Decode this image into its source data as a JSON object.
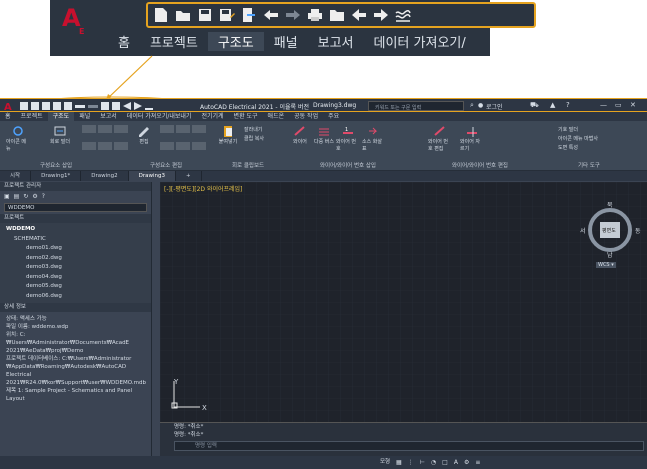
{
  "zoom": {
    "logo_letter": "A",
    "logo_sub": "E",
    "toolbar_icons": [
      "new-icon",
      "open-icon",
      "save-icon",
      "save-as-icon",
      "publish-icon",
      "undo-icon",
      "redo-icon",
      "print-icon",
      "folder-icon",
      "back-icon",
      "forward-icon",
      "workspace-icon"
    ],
    "tabs": [
      "홈",
      "프로젝트",
      "구조도",
      "패널",
      "보고서",
      "데이터 가져오기/"
    ]
  },
  "title": {
    "app": "AutoCAD Electrical 2021 - 이율록 버전",
    "file": "Drawing3.dwg",
    "search_placeholder": "키워드 또는 구문 입력",
    "login": "로그인"
  },
  "ribbon_tabs": [
    "홈",
    "프로젝트",
    "구조도",
    "패널",
    "보고서",
    "데이터 가져오기/내보내기",
    "전기기계",
    "변환 도구",
    "애드온",
    "공동 작업",
    "주요"
  ],
  "panels": {
    "insert_components": "구성요소 삽입",
    "edit_components": "구성요소 편집",
    "clipboard": "회로 클립보드",
    "insert_wires": "와이어/와이어 번호 삽입",
    "edit_wires": "와이어/와이어 번호 편집",
    "other_tools": "기타 도구"
  },
  "ribbon_buttons": {
    "icon_menu": "아이콘 메뉴",
    "circuit_builder": "회로 빌더",
    "edit": "편집",
    "cut": "잘라내기",
    "copy_clip": "클립 복사",
    "paste": "붙여넣기",
    "wire": "와이어",
    "multi_bus": "다중 버스",
    "wire_number": "와이어 번호",
    "source_signal": "소스 화살표",
    "wire_number_edit": "와이어 번호 편집",
    "wire_trim": "와이어 자르기",
    "block_builder": "기호 빌더",
    "icon_menu_wizard": "아이콘 메뉴 마법사",
    "drawing_properties": "도면 특성"
  },
  "doc_tabs": [
    "시작",
    "Drawing1*",
    "Drawing2",
    "Drawing3"
  ],
  "project_manager": {
    "title": "프로젝트 관리자",
    "project_select": "WDDEMO",
    "projects_label": "프로젝트",
    "tree": [
      "WDDEMO",
      "SCHEMATIC",
      "demo01.dwg",
      "demo02.dwg",
      "demo03.dwg",
      "demo04.dwg",
      "demo05.dwg",
      "demo06.dwg"
    ],
    "details_title": "상세 정보",
    "details": [
      "상태: 액세스 가능",
      "파일 이름: wddemo.wdp",
      "",
      "위치: C:₩Users₩Administrator₩Documents₩AcadE 2021₩AeData₩proj₩Demo",
      "",
      "프로젝트 데이터베이스: C:₩Users₩Administrator ₩AppData₩Roaming₩Autodesk₩AutoCAD Electrical 2021₩R24.0₩kor₩Support₩user₩WDDEMO.mdb",
      "",
      "제목 1: Sample Project - Schematics and Panel Layout"
    ]
  },
  "canvas": {
    "view_label": "[-][-평면도][2D 와이어프레임]",
    "compass": {
      "n": "북",
      "s": "남",
      "e": "동",
      "w": "서",
      "top": "평면도"
    },
    "wcs": "WCS ▾",
    "axis_x": "X",
    "axis_y": "Y"
  },
  "command": {
    "line1": "명령: *취소*",
    "line2": "명령: *취소*",
    "input_placeholder": "명령 입력"
  },
  "status": {
    "model": "모형"
  },
  "colors": {
    "accent": "#e5a320",
    "logo_red": "#c8102e",
    "ribbon_bg": "#3d4856",
    "canvas_bg": "#1f232b"
  }
}
